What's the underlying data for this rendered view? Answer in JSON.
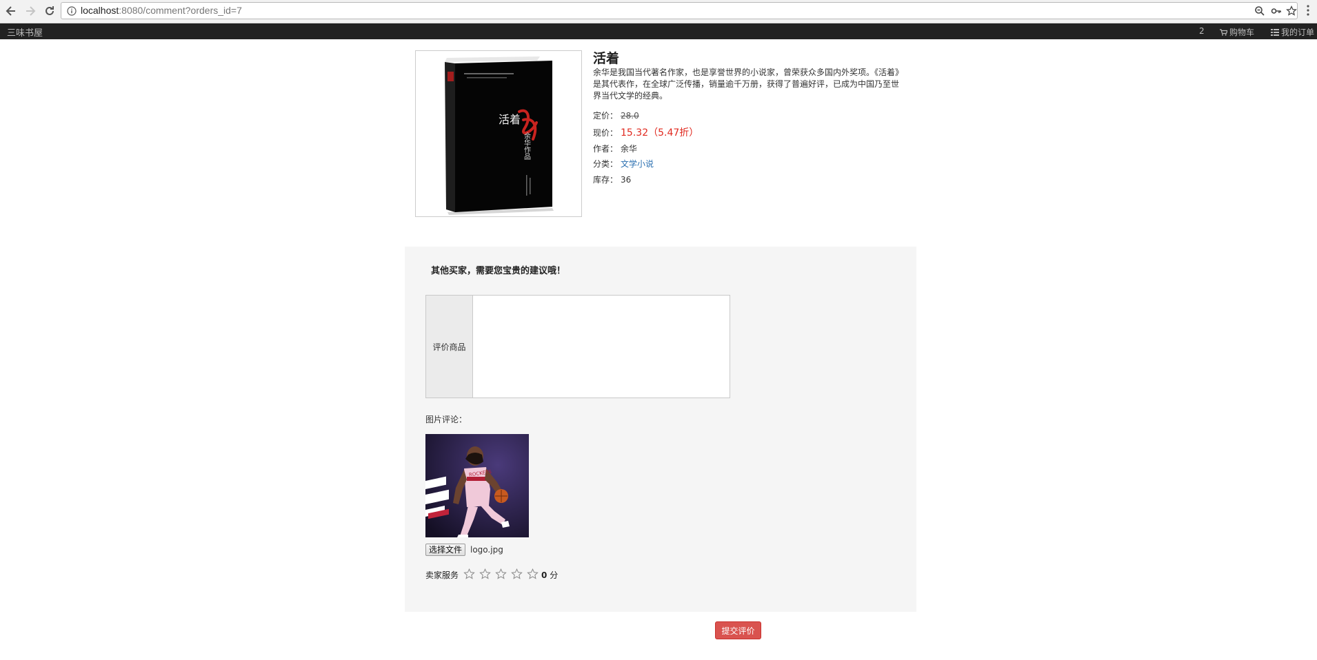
{
  "browser": {
    "url_host": "localhost",
    "url_path": ":8080/comment?orders_id=7"
  },
  "navbar": {
    "brand": "三味书屋",
    "cart_count": "2",
    "cart_label": "购物车",
    "orders_label": "我的订单"
  },
  "product": {
    "title": "活着",
    "description": "余华是我国当代著名作家，也是享誉世界的小说家，曾荣获众多国内外奖项。《活着》是其代表作，在全球广泛传播，销量逾千万册，获得了普遍好评，已成为中国乃至世界当代文学的经典。",
    "list_price_label": "定价：",
    "list_price": "28.0",
    "current_price_label": "现价：",
    "current_price": "15.32（5.47折）",
    "author_label": "作者：",
    "author": "余华",
    "category_label": "分类：",
    "category": "文学小说",
    "stock_label": "库存：",
    "stock": "36",
    "cover_text": {
      "title": "活着",
      "author": "余华作品"
    }
  },
  "comment": {
    "heading": "其他买家，需要您宝贵的建议哦！",
    "field_label": "评价商品",
    "text": "",
    "photo_label": "图片评论：",
    "file_button": "选择文件",
    "file_name": "logo.jpg",
    "photo_text": "ROCKETS"
  },
  "rating": {
    "label": "卖家服务",
    "max_stars": 5,
    "score": "0",
    "unit": "分"
  },
  "submit_label": "提交评价",
  "colors": {
    "accent_red": "#d9534f",
    "price_red": "#e0281e",
    "link_blue": "#2a6fb0",
    "navbar_bg": "#222222"
  }
}
